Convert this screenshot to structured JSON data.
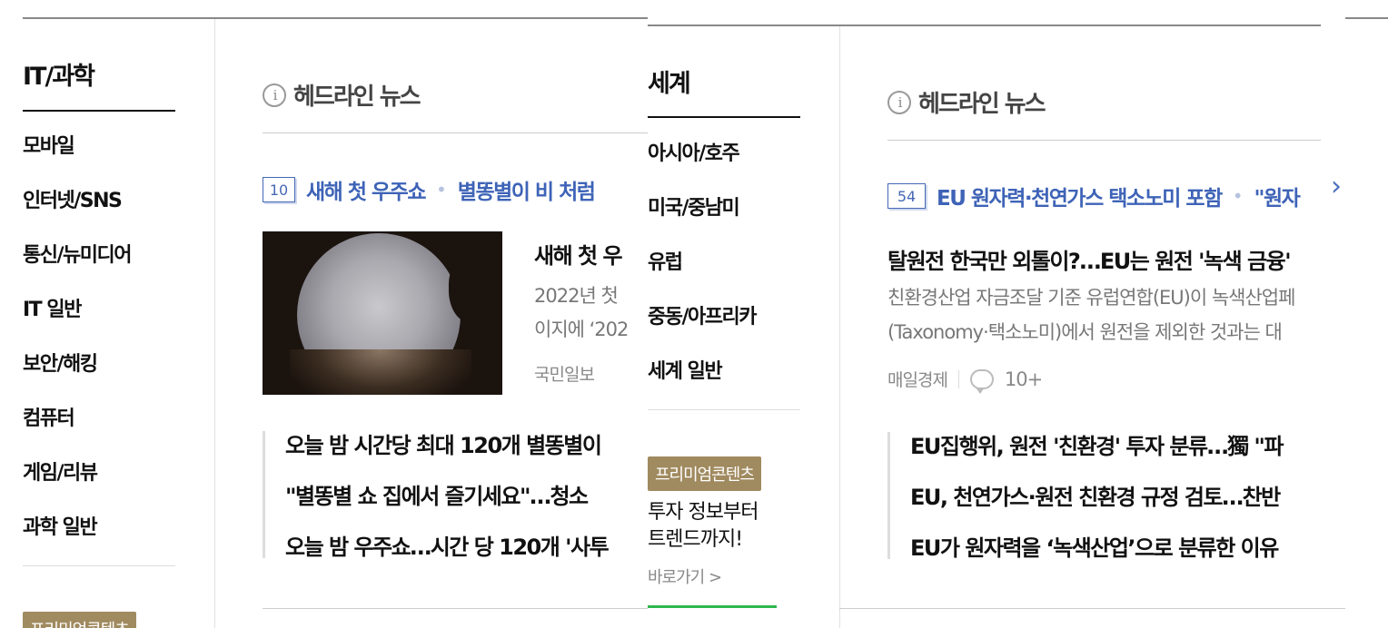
{
  "left": {
    "section_title": "IT/과학",
    "menu": [
      "모바일",
      "인터넷/SNS",
      "통신/뉴미디어",
      "IT 일반",
      "보안/해킹",
      "컴퓨터",
      "게임/리뷰",
      "과학 일반"
    ],
    "headline_label": "헤드라인 뉴스",
    "count": "10",
    "topics": [
      "새해 첫 우주쇼",
      "별똥별이 비 처럼"
    ],
    "main_headline": "새해 첫 우",
    "summary_lines": [
      "2022년 첫",
      "이지에 ‘202"
    ],
    "press": "국민일보",
    "related": [
      "오늘 밤 시간당 최대 120개 별똥별이",
      "\"별똥별 쇼 집에서 즐기세요\"…청소",
      "오늘 밤 우주쇼…시간 당 120개 '사투"
    ],
    "premium_label": "프리미엄콘텐츠"
  },
  "right": {
    "section_title": "세계",
    "menu": [
      "아시아/호주",
      "미국/중남미",
      "유럽",
      "중동/아프리카",
      "세계 일반"
    ],
    "premium_label": "프리미엄콘텐츠",
    "promo_lines": [
      "투자 정보부터",
      "트렌드까지!"
    ],
    "promo_link": "바로가기 >",
    "headline_label": "헤드라인 뉴스",
    "count": "54",
    "topics": [
      "EU 원자력·천연가스 택소노미 포함",
      "\"원자"
    ],
    "main_headline": "탈원전 한국만 외톨이?…EU는 원전 '녹색 금융'",
    "summary_lines": [
      "친환경산업 자금조달 기준 유럽연합(EU)이 녹색산업페",
      "(Taxonomy·택소노미)에서 원전을 제외한 것과는 대"
    ],
    "press": "매일경제",
    "comments": "10+",
    "related": [
      "EU집행위, 원전 '친환경' 투자 분류…獨 \"파",
      "EU, 천연가스·원전 친환경 규정 검토…찬반",
      "EU가 원자력을 ‘녹색산업’으로 분류한 이유"
    ]
  },
  "icons": {
    "info": "info-icon",
    "next": "chevron-right-icon",
    "comment": "comment-icon"
  },
  "colors": {
    "topic_blue": "#3e63b7",
    "premium": "#a08a5f",
    "green": "#2db84e"
  }
}
